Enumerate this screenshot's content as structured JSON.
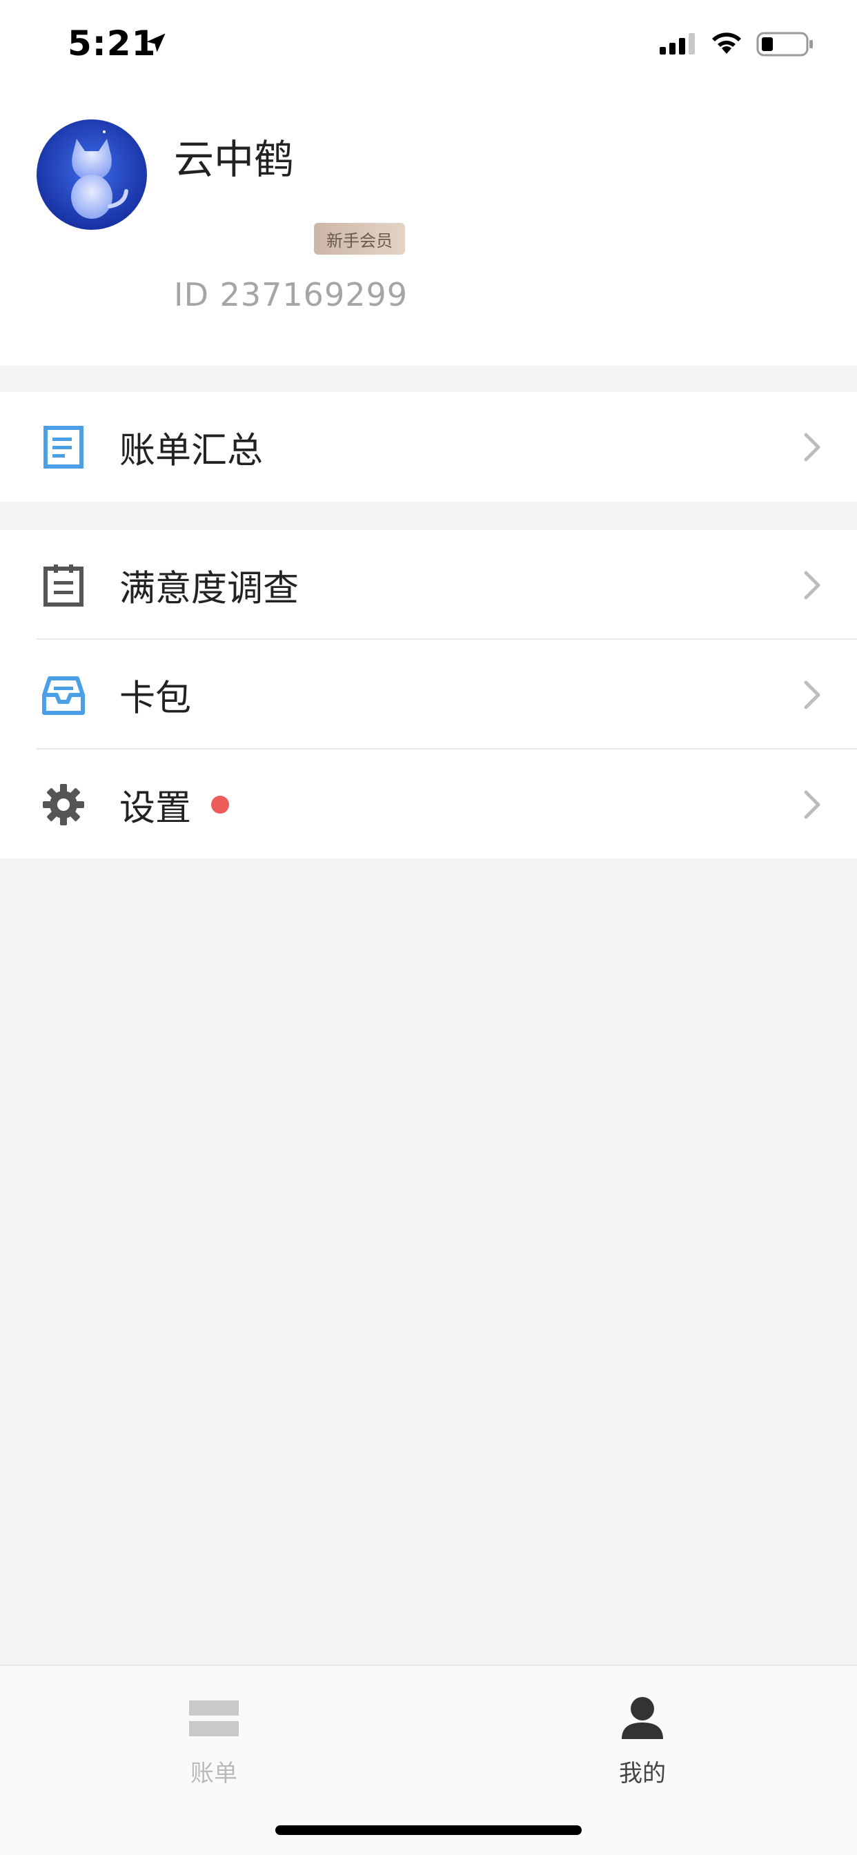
{
  "status_bar": {
    "time": "5:21"
  },
  "profile": {
    "username": "云中鹤",
    "member_badge": "新手会员",
    "user_id": "ID 237169299"
  },
  "menu": {
    "bill_summary": "账单汇总",
    "survey": "满意度调查",
    "card_wallet": "卡包",
    "settings": "设置"
  },
  "tabs": {
    "bills": "账单",
    "mine": "我的"
  },
  "colors": {
    "accent_blue": "#4a9fe6",
    "badge_dot": "#ee5b5b",
    "avatar_bg": "#1c3fb8"
  },
  "icons": {
    "bill_summary": "document-icon",
    "survey": "clipboard-icon",
    "card_wallet": "inbox-tray-icon",
    "settings": "gear-icon"
  }
}
